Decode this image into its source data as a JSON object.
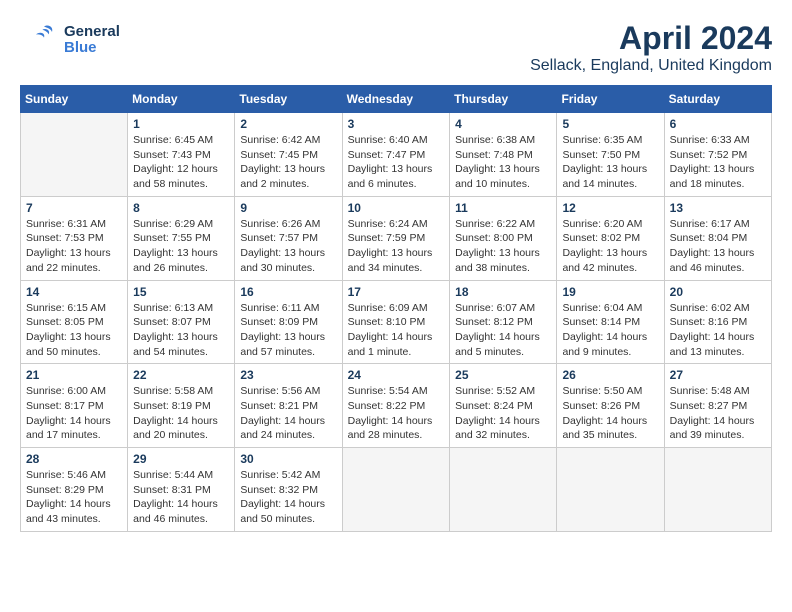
{
  "header": {
    "logo_general": "General",
    "logo_blue": "Blue",
    "month": "April 2024",
    "location": "Sellack, England, United Kingdom"
  },
  "days_of_week": [
    "Sunday",
    "Monday",
    "Tuesday",
    "Wednesday",
    "Thursday",
    "Friday",
    "Saturday"
  ],
  "weeks": [
    [
      {
        "day": "",
        "info": ""
      },
      {
        "day": "1",
        "info": "Sunrise: 6:45 AM\nSunset: 7:43 PM\nDaylight: 12 hours\nand 58 minutes."
      },
      {
        "day": "2",
        "info": "Sunrise: 6:42 AM\nSunset: 7:45 PM\nDaylight: 13 hours\nand 2 minutes."
      },
      {
        "day": "3",
        "info": "Sunrise: 6:40 AM\nSunset: 7:47 PM\nDaylight: 13 hours\nand 6 minutes."
      },
      {
        "day": "4",
        "info": "Sunrise: 6:38 AM\nSunset: 7:48 PM\nDaylight: 13 hours\nand 10 minutes."
      },
      {
        "day": "5",
        "info": "Sunrise: 6:35 AM\nSunset: 7:50 PM\nDaylight: 13 hours\nand 14 minutes."
      },
      {
        "day": "6",
        "info": "Sunrise: 6:33 AM\nSunset: 7:52 PM\nDaylight: 13 hours\nand 18 minutes."
      }
    ],
    [
      {
        "day": "7",
        "info": "Sunrise: 6:31 AM\nSunset: 7:53 PM\nDaylight: 13 hours\nand 22 minutes."
      },
      {
        "day": "8",
        "info": "Sunrise: 6:29 AM\nSunset: 7:55 PM\nDaylight: 13 hours\nand 26 minutes."
      },
      {
        "day": "9",
        "info": "Sunrise: 6:26 AM\nSunset: 7:57 PM\nDaylight: 13 hours\nand 30 minutes."
      },
      {
        "day": "10",
        "info": "Sunrise: 6:24 AM\nSunset: 7:59 PM\nDaylight: 13 hours\nand 34 minutes."
      },
      {
        "day": "11",
        "info": "Sunrise: 6:22 AM\nSunset: 8:00 PM\nDaylight: 13 hours\nand 38 minutes."
      },
      {
        "day": "12",
        "info": "Sunrise: 6:20 AM\nSunset: 8:02 PM\nDaylight: 13 hours\nand 42 minutes."
      },
      {
        "day": "13",
        "info": "Sunrise: 6:17 AM\nSunset: 8:04 PM\nDaylight: 13 hours\nand 46 minutes."
      }
    ],
    [
      {
        "day": "14",
        "info": "Sunrise: 6:15 AM\nSunset: 8:05 PM\nDaylight: 13 hours\nand 50 minutes."
      },
      {
        "day": "15",
        "info": "Sunrise: 6:13 AM\nSunset: 8:07 PM\nDaylight: 13 hours\nand 54 minutes."
      },
      {
        "day": "16",
        "info": "Sunrise: 6:11 AM\nSunset: 8:09 PM\nDaylight: 13 hours\nand 57 minutes."
      },
      {
        "day": "17",
        "info": "Sunrise: 6:09 AM\nSunset: 8:10 PM\nDaylight: 14 hours\nand 1 minute."
      },
      {
        "day": "18",
        "info": "Sunrise: 6:07 AM\nSunset: 8:12 PM\nDaylight: 14 hours\nand 5 minutes."
      },
      {
        "day": "19",
        "info": "Sunrise: 6:04 AM\nSunset: 8:14 PM\nDaylight: 14 hours\nand 9 minutes."
      },
      {
        "day": "20",
        "info": "Sunrise: 6:02 AM\nSunset: 8:16 PM\nDaylight: 14 hours\nand 13 minutes."
      }
    ],
    [
      {
        "day": "21",
        "info": "Sunrise: 6:00 AM\nSunset: 8:17 PM\nDaylight: 14 hours\nand 17 minutes."
      },
      {
        "day": "22",
        "info": "Sunrise: 5:58 AM\nSunset: 8:19 PM\nDaylight: 14 hours\nand 20 minutes."
      },
      {
        "day": "23",
        "info": "Sunrise: 5:56 AM\nSunset: 8:21 PM\nDaylight: 14 hours\nand 24 minutes."
      },
      {
        "day": "24",
        "info": "Sunrise: 5:54 AM\nSunset: 8:22 PM\nDaylight: 14 hours\nand 28 minutes."
      },
      {
        "day": "25",
        "info": "Sunrise: 5:52 AM\nSunset: 8:24 PM\nDaylight: 14 hours\nand 32 minutes."
      },
      {
        "day": "26",
        "info": "Sunrise: 5:50 AM\nSunset: 8:26 PM\nDaylight: 14 hours\nand 35 minutes."
      },
      {
        "day": "27",
        "info": "Sunrise: 5:48 AM\nSunset: 8:27 PM\nDaylight: 14 hours\nand 39 minutes."
      }
    ],
    [
      {
        "day": "28",
        "info": "Sunrise: 5:46 AM\nSunset: 8:29 PM\nDaylight: 14 hours\nand 43 minutes."
      },
      {
        "day": "29",
        "info": "Sunrise: 5:44 AM\nSunset: 8:31 PM\nDaylight: 14 hours\nand 46 minutes."
      },
      {
        "day": "30",
        "info": "Sunrise: 5:42 AM\nSunset: 8:32 PM\nDaylight: 14 hours\nand 50 minutes."
      },
      {
        "day": "",
        "info": ""
      },
      {
        "day": "",
        "info": ""
      },
      {
        "day": "",
        "info": ""
      },
      {
        "day": "",
        "info": ""
      }
    ]
  ]
}
